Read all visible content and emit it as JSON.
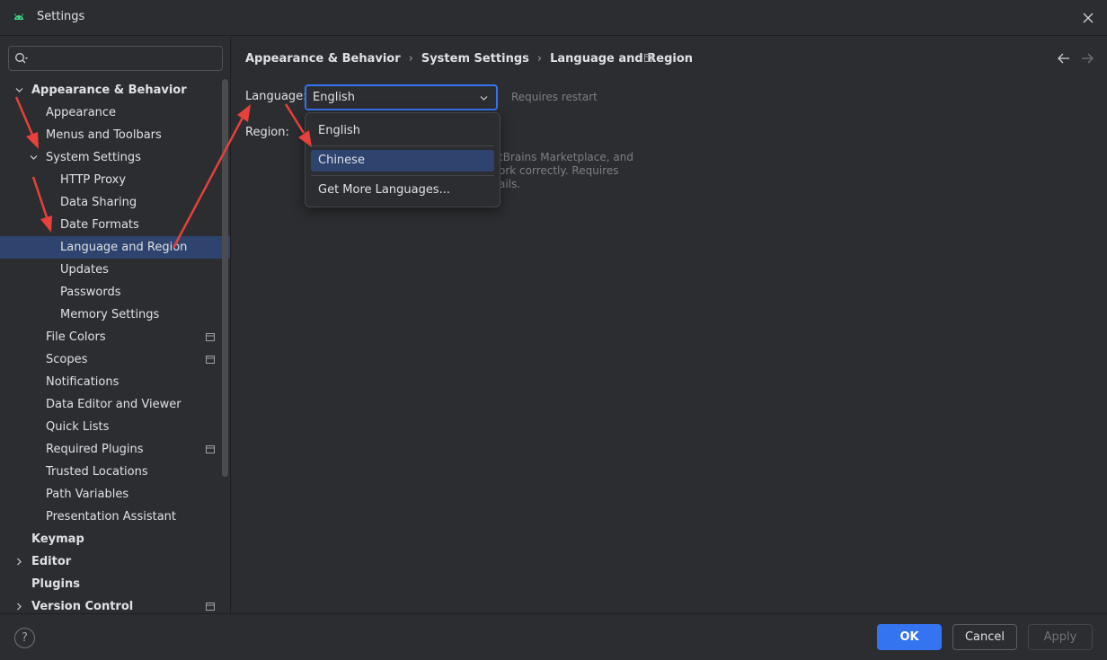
{
  "window": {
    "title": "Settings"
  },
  "search": {
    "placeholder": "",
    "value": ""
  },
  "tree": {
    "items": [
      {
        "label": "Appearance & Behavior"
      },
      {
        "label": "Appearance"
      },
      {
        "label": "Menus and Toolbars"
      },
      {
        "label": "System Settings"
      },
      {
        "label": "HTTP Proxy"
      },
      {
        "label": "Data Sharing"
      },
      {
        "label": "Date Formats"
      },
      {
        "label": "Language and Region"
      },
      {
        "label": "Updates"
      },
      {
        "label": "Passwords"
      },
      {
        "label": "Memory Settings"
      },
      {
        "label": "File Colors"
      },
      {
        "label": "Scopes"
      },
      {
        "label": "Notifications"
      },
      {
        "label": "Data Editor and Viewer"
      },
      {
        "label": "Quick Lists"
      },
      {
        "label": "Required Plugins"
      },
      {
        "label": "Trusted Locations"
      },
      {
        "label": "Path Variables"
      },
      {
        "label": "Presentation Assistant"
      },
      {
        "label": "Keymap"
      },
      {
        "label": "Editor"
      },
      {
        "label": "Plugins"
      },
      {
        "label": "Version Control"
      }
    ]
  },
  "breadcrumb": {
    "items": [
      "Appearance & Behavior",
      "System Settings",
      "Language and Region"
    ],
    "separator": "›"
  },
  "form": {
    "language_label": "Language:",
    "language_value": "English",
    "restart_note": "Requires restart",
    "region_label": "Region:",
    "info_lines": [
      "tBrains Marketplace, and",
      "ork correctly. Requires",
      "ails."
    ]
  },
  "dropdown": {
    "options": [
      "English",
      "Chinese",
      "Get More Languages..."
    ],
    "highlighted": "Chinese"
  },
  "footer": {
    "help_label": "?",
    "ok_label": "OK",
    "cancel_label": "Cancel",
    "apply_label": "Apply"
  },
  "colors": {
    "background": "#2b2d30",
    "selection": "#2e436e",
    "accent": "#3574f0",
    "annotation_arrow": "#e8403a",
    "app_icon": "#3ddc84"
  }
}
